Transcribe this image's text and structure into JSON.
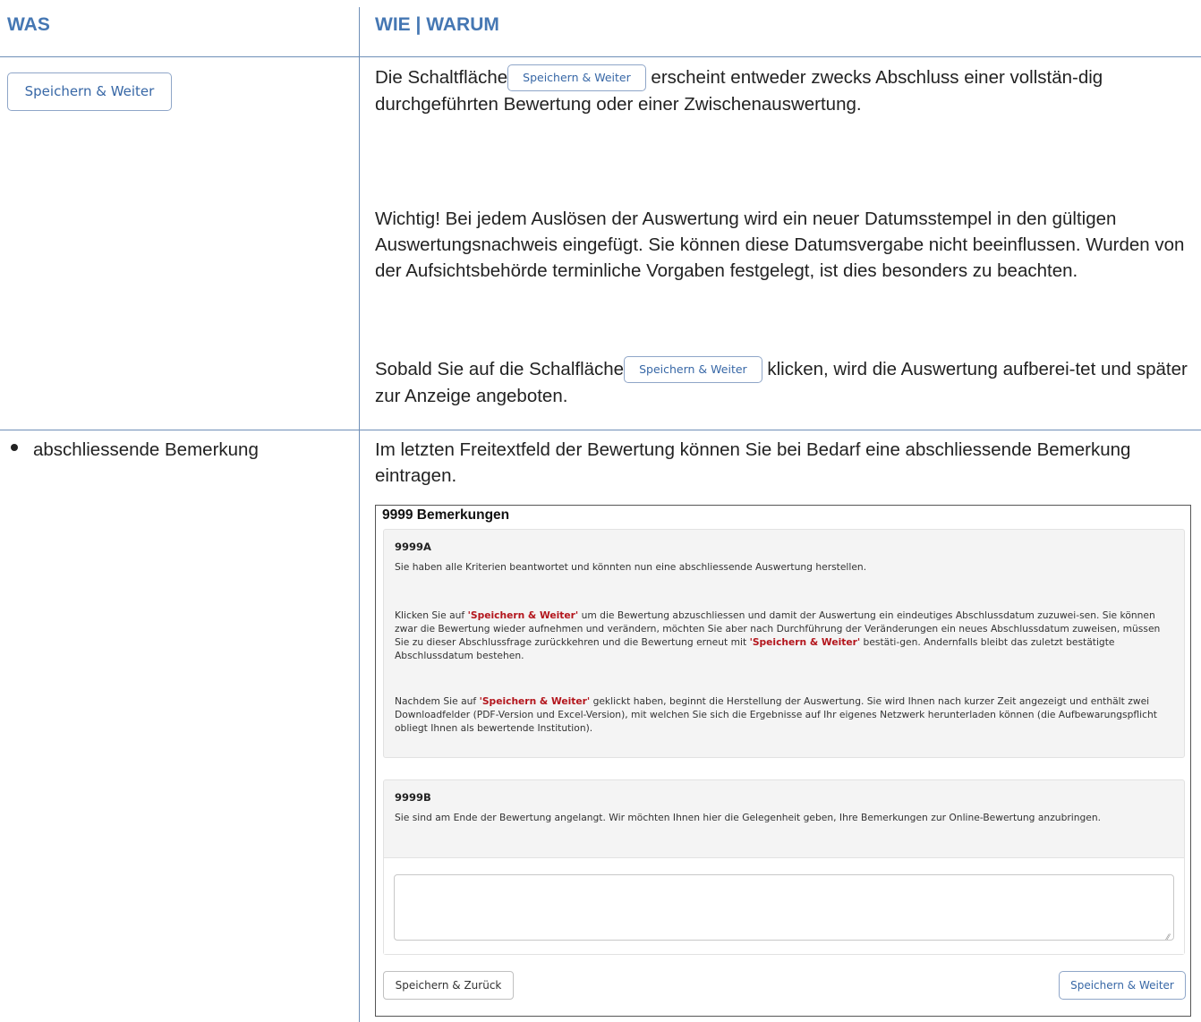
{
  "header": {
    "col1": "WAS",
    "col2": "WIE | WARUM"
  },
  "row1": {
    "button_label": "Speichern & Weiter",
    "p1_before": "Die Schaltfläche",
    "p1_after": " erscheint entweder zwecks Abschluss einer vollstän-dig durchgeführten Bewertung oder einer Zwischenauswertung.",
    "p2": "Wichtig! Bei jedem Auslösen der Auswertung wird ein neuer Datumsstempel in den gültigen Auswertungsnachweis eingefügt. Sie können diese Datumsvergabe nicht beeinflussen. Wurden von der Aufsichtsbehörde terminliche Vorgaben festgelegt, ist dies besonders zu beachten.",
    "p3_before": "Sobald Sie auf die Schalfläche",
    "p3_after": " klicken, wird die Auswertung aufberei-tet und später zur Anzeige angeboten."
  },
  "row2": {
    "bullet": "abschliessende Bemerkung",
    "desc": "Im letzten Freitextfeld der Bewertung können Sie bei Bedarf eine abschliessende Bemerkung eintragen."
  },
  "screenshot": {
    "title": "9999 Bemerkungen",
    "cardA": {
      "id": "9999A",
      "line1": "Sie haben alle Kriterien beantwortet und könnten nun eine abschliessende Auswertung herstellen.",
      "p2_a": "Klicken Sie auf ",
      "hl": "'Speichern & Weiter'",
      "p2_b": " um die Bewertung abzuschliessen und damit der Auswertung ein eindeutiges Abschlussdatum zuzuwei-sen. Sie können zwar die Bewertung wieder aufnehmen und verändern, möchten Sie aber nach Durchführung der Veränderungen ein neues Abschlussdatum zuweisen, müssen Sie zu dieser Abschlussfrage zurückkehren und die Bewertung erneut mit ",
      "p2_c": " bestäti-gen. Andernfalls bleibt das zuletzt bestätigte Abschlussdatum bestehen.",
      "p3_a": "Nachdem Sie auf ",
      "p3_b": " geklickt haben, beginnt die Herstellung der Auswertung. Sie wird Ihnen nach kurzer Zeit angezeigt und enthält zwei Downloadfelder (PDF-Version und Excel-Version), mit welchen Sie sich die Ergebnisse auf Ihr eigenes Netzwerk herunterladen können (die Aufbewarungspflicht obliegt Ihnen als bewertende Institution)."
    },
    "cardB": {
      "id": "9999B",
      "text": "Sie sind am Ende der Bewertung angelangt. Wir möchten Ihnen hier die Gelegenheit geben, Ihre Bemerkungen zur Online-Bewertung anzubringen.",
      "textarea_value": ""
    },
    "btn_back": "Speichern & Zurück",
    "btn_next": "Speichern & Weiter"
  },
  "colors": {
    "header_blue": "#4577b3",
    "rule": "#6f8fb8",
    "highlight_red": "#b3151c"
  }
}
